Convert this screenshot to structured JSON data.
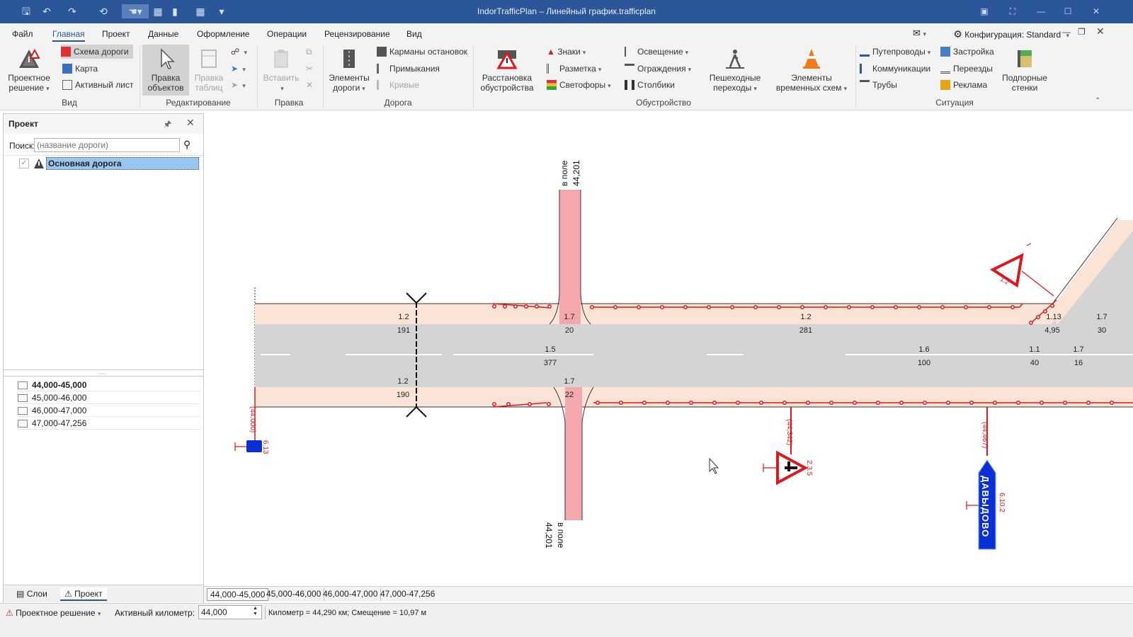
{
  "titlebar": {
    "title": "IndorTrafficPlan – Линейный график.trafficplan",
    "qat_icons": [
      "save-icon",
      "undo-icon",
      "redo-icon",
      "refresh-icon",
      "select-icon",
      "layout-icon",
      "page-icon",
      "table-icon",
      "dropdown-icon"
    ],
    "window_buttons": [
      "restore-icon",
      "fullscreen-icon",
      "minimize-icon",
      "maximize-icon",
      "close-icon"
    ]
  },
  "menu": {
    "tabs": [
      "Файл",
      "Главная",
      "Проект",
      "Данные",
      "Оформление",
      "Операции",
      "Рецензирование",
      "Вид"
    ],
    "active": "Главная",
    "config_label": "Конфигурация: Standard"
  },
  "ribbon": {
    "groups": [
      "Вид",
      "Редактирование",
      "Правка",
      "Дорога",
      "Обустройство",
      "Ситуация"
    ],
    "vid": {
      "project_solution": "Проектное решение",
      "road_scheme": "Схема дороги",
      "map": "Карта",
      "active_sheet": "Активный лист"
    },
    "edit": {
      "edit_objects": "Правка объектов",
      "edit_tables": "Правка таблиц"
    },
    "pravka": {
      "insert": "Вставить"
    },
    "road": {
      "road_elements": "Элементы дороги",
      "bus_stops": "Карманы остановок",
      "junctions": "Примыкания",
      "curves": "Кривые"
    },
    "equipment": {
      "placement": "Расстановка обустройства",
      "signs": "Знаки",
      "marking": "Разметка",
      "traffic_lights": "Светофоры",
      "lighting": "Освещение",
      "fences": "Ограждения",
      "posts": "Столбики",
      "crossings": "Пешеходные переходы",
      "temp_schemes": "Элементы временных схем"
    },
    "situation": {
      "overpasses": "Путепроводы",
      "utilities": "Коммуникации",
      "pipes": "Трубы",
      "buildings": "Застройка",
      "rail_crossings": "Переезды",
      "ads": "Реклама",
      "retaining_walls": "Подпорные стенки"
    }
  },
  "left_panel": {
    "title": "Проект",
    "search_label": "Поиск:",
    "search_placeholder": "(название дороги)",
    "tree_root": "Основная дорога",
    "sections": [
      "44,000-45,000",
      "45,000-46,000",
      "46,000-47,000",
      "47,000-47,256"
    ],
    "active_section": "44,000-45,000",
    "tabs": [
      "Слои",
      "Проект"
    ],
    "active_tab": "Проект"
  },
  "drawing": {
    "road_top_left_edge": [
      "1.2",
      "191"
    ],
    "junction_top": [
      "1.7",
      "20"
    ],
    "top_mid": [
      "1.2",
      "281"
    ],
    "top_right_1": [
      "1.13",
      "4,95"
    ],
    "top_right_2": [
      "1.7",
      "30"
    ],
    "center_left": [
      "1.5",
      "377"
    ],
    "center_mid": [
      "1.6",
      "100"
    ],
    "center_r1": [
      "1.1",
      "40"
    ],
    "center_r2": [
      "1.7",
      "16"
    ],
    "bottom_left": [
      "1.2",
      "190"
    ],
    "junction_bottom": [
      "1.7",
      "22"
    ],
    "road_top_label": [
      "в поле",
      "44,201"
    ],
    "road_bottom_label": [
      "в поле",
      "44,201"
    ],
    "sign_km_left": "(44,000)",
    "sign_code_left": "6.13",
    "sign_km_mid": "(44,342)",
    "sign_code_mid": "2.3.5",
    "sign_km_right": "(44,467)",
    "sign_code_right": "6.10.2",
    "sign_right_text": "ДАВЫДОВО",
    "sign_top_right_code": "1.2"
  },
  "sheet_tabs": [
    "44,000-45,000",
    "45,000-46,000",
    "46,000-47,000",
    "47,000-47,256"
  ],
  "active_sheet_tab": "44,000-45,000",
  "status": {
    "solution": "Проектное решение",
    "km_label": "Активный километр:",
    "km_value": "44,000",
    "info": "Километр = 44,290 км; Смещение = 10,97 м"
  },
  "colors": {
    "accent": "#2b579a",
    "shoulder": "#fbe4d6",
    "asphalt": "#d4d4d4",
    "junction": "#f4a8ad",
    "fence": "#e0161c",
    "sign_blue": "#0a2fd6",
    "sign_red": "#e0161c"
  }
}
